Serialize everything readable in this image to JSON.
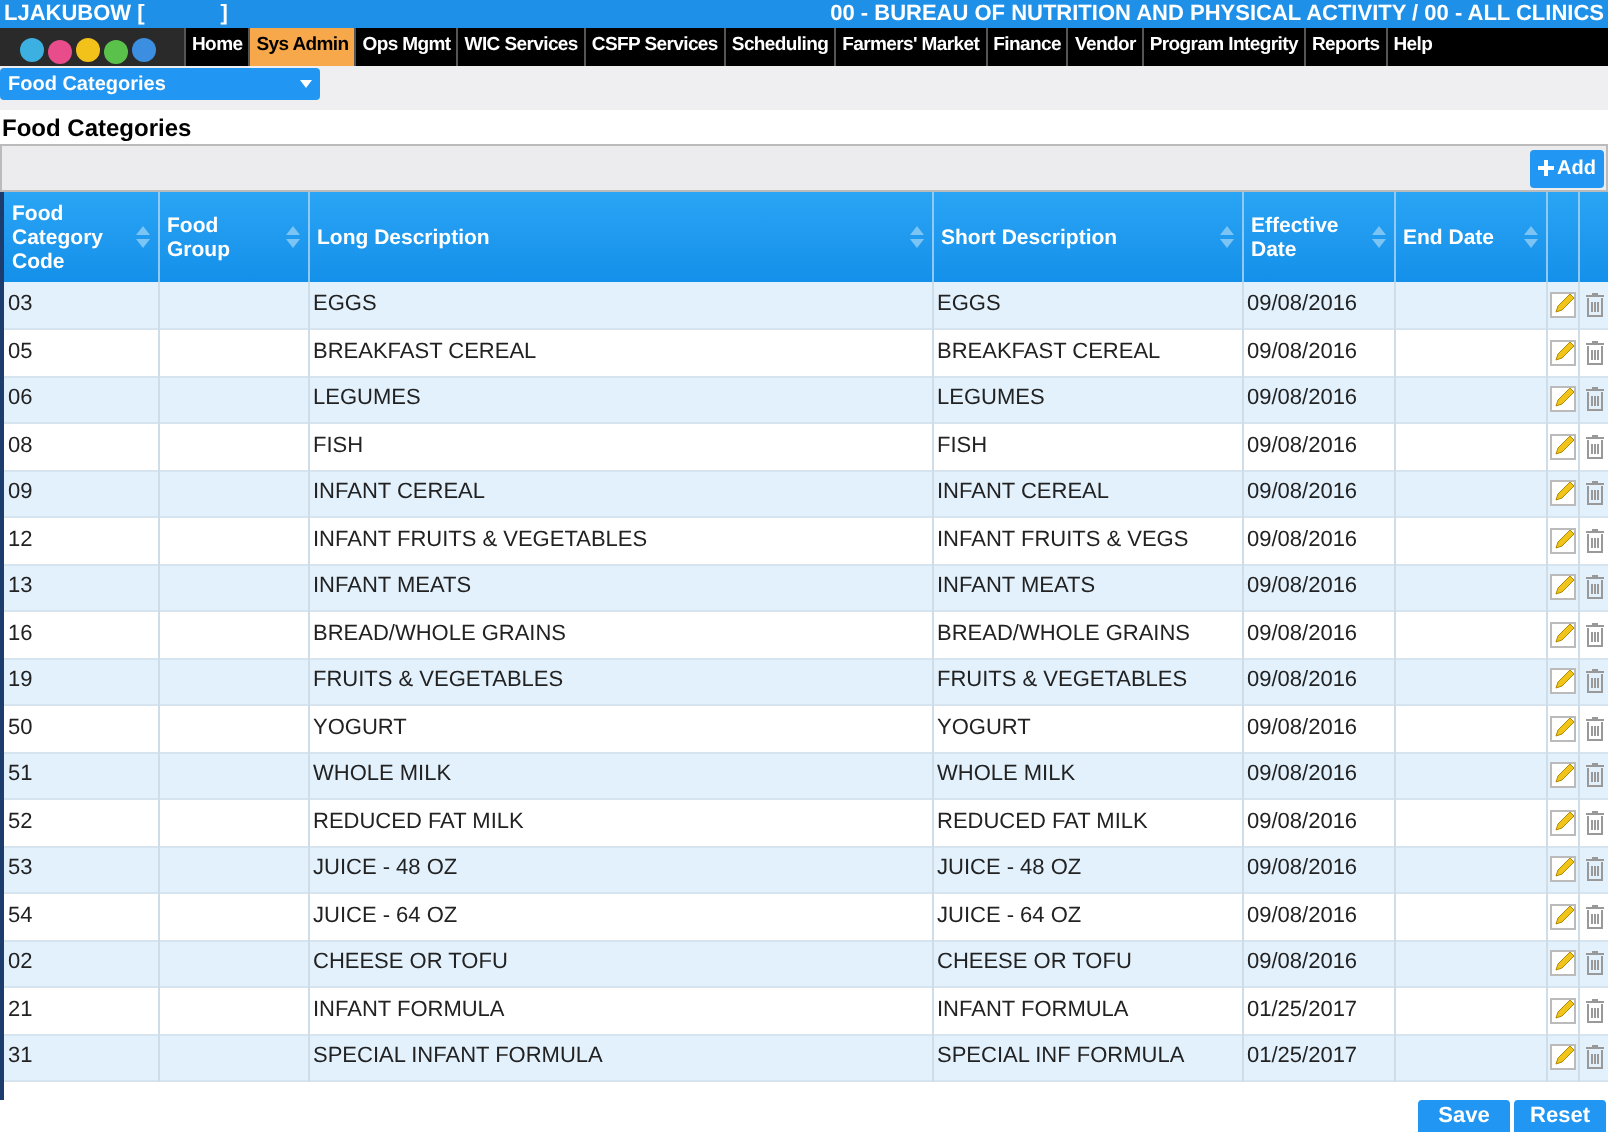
{
  "top_bar": {
    "user": "LJAKUBOW [",
    "user_end": "]",
    "agency": "00 - BUREAU OF NUTRITION AND PHYSICAL ACTIVITY / 00 - ALL CLINICS"
  },
  "nav": [
    {
      "label": "Home",
      "selected": false
    },
    {
      "label": "Sys Admin",
      "selected": true
    },
    {
      "label": "Ops Mgmt",
      "selected": false
    },
    {
      "label": "WIC Services",
      "selected": false
    },
    {
      "label": "CSFP Services",
      "selected": false
    },
    {
      "label": "Scheduling",
      "selected": false
    },
    {
      "label": "Farmers' Market",
      "selected": false
    },
    {
      "label": "Finance",
      "selected": false
    },
    {
      "label": "Vendor",
      "selected": false
    },
    {
      "label": "Program Integrity",
      "selected": false
    },
    {
      "label": "Reports",
      "selected": false
    },
    {
      "label": "Help",
      "selected": false
    }
  ],
  "page_dropdown": {
    "value": "Food Categories"
  },
  "title": "Food Categories",
  "add_button": "Add",
  "table": {
    "columns": [
      "Food Category Code",
      "Food Group",
      "Long Description",
      "Short Description",
      "Effective Date",
      "End Date"
    ],
    "rows": [
      [
        "03",
        "",
        "EGGS",
        "EGGS",
        "09/08/2016",
        ""
      ],
      [
        "05",
        "",
        "BREAKFAST CEREAL",
        "BREAKFAST CEREAL",
        "09/08/2016",
        ""
      ],
      [
        "06",
        "",
        "LEGUMES",
        "LEGUMES",
        "09/08/2016",
        ""
      ],
      [
        "08",
        "",
        "FISH",
        "FISH",
        "09/08/2016",
        ""
      ],
      [
        "09",
        "",
        "INFANT CEREAL",
        "INFANT CEREAL",
        "09/08/2016",
        ""
      ],
      [
        "12",
        "",
        "INFANT FRUITS & VEGETABLES",
        "INFANT FRUITS & VEGS",
        "09/08/2016",
        ""
      ],
      [
        "13",
        "",
        "INFANT MEATS",
        "INFANT MEATS",
        "09/08/2016",
        ""
      ],
      [
        "16",
        "",
        "BREAD/WHOLE GRAINS",
        "BREAD/WHOLE GRAINS",
        "09/08/2016",
        ""
      ],
      [
        "19",
        "",
        "FRUITS & VEGETABLES",
        "FRUITS & VEGETABLES",
        "09/08/2016",
        ""
      ],
      [
        "50",
        "",
        "YOGURT",
        "YOGURT",
        "09/08/2016",
        ""
      ],
      [
        "51",
        "",
        "WHOLE MILK",
        "WHOLE MILK",
        "09/08/2016",
        ""
      ],
      [
        "52",
        "",
        "REDUCED FAT MILK",
        "REDUCED FAT MILK",
        "09/08/2016",
        ""
      ],
      [
        "53",
        "",
        "JUICE - 48 OZ",
        "JUICE - 48 OZ",
        "09/08/2016",
        ""
      ],
      [
        "54",
        "",
        "JUICE - 64 OZ",
        "JUICE - 64 OZ",
        "09/08/2016",
        ""
      ],
      [
        "02",
        "",
        "CHEESE OR TOFU",
        "CHEESE OR TOFU",
        "09/08/2016",
        ""
      ],
      [
        "21",
        "",
        "INFANT FORMULA",
        "INFANT FORMULA",
        "01/25/2017",
        ""
      ],
      [
        "31",
        "",
        "SPECIAL INFANT FORMULA",
        "SPECIAL INF FORMULA",
        "01/25/2017",
        ""
      ]
    ]
  },
  "buttons": [
    "Save",
    "Reset"
  ]
}
